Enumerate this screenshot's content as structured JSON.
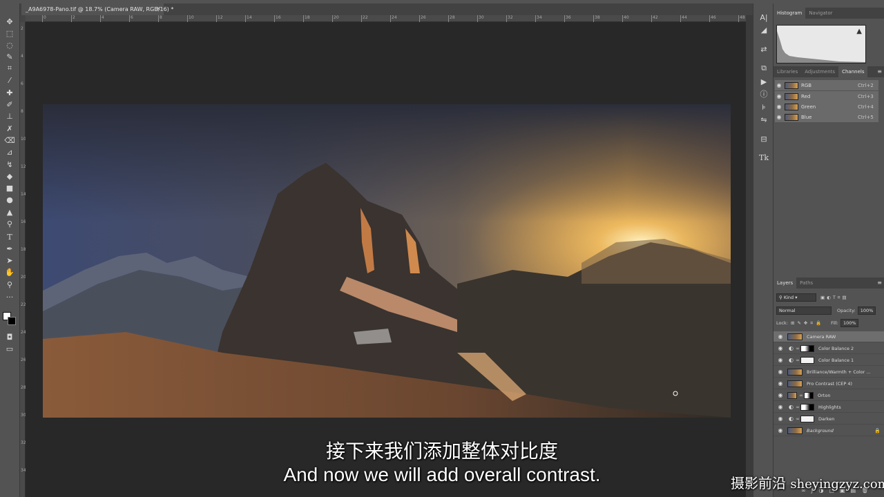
{
  "app": {
    "document_tab": "_A9A6978-Pano.tif @ 18.7% (Camera RAW, RGB/16) *",
    "tab_close": "×"
  },
  "ruler": {
    "h_ticks": [
      "0",
      "2",
      "4",
      "6",
      "8",
      "10",
      "12",
      "14",
      "16",
      "18",
      "20",
      "22",
      "24",
      "26",
      "28",
      "30",
      "32",
      "34",
      "36",
      "38",
      "40",
      "42",
      "44",
      "46",
      "48"
    ],
    "v_ticks": [
      "2",
      "4",
      "6",
      "8",
      "10",
      "12",
      "14",
      "16",
      "18",
      "20",
      "22",
      "24",
      "26",
      "28",
      "30",
      "32",
      "34"
    ]
  },
  "tools": [
    "move-icon",
    "marquee-icon",
    "lasso-icon",
    "quick-select-icon",
    "crop-icon",
    "eyedropper-icon",
    "healing-icon",
    "brush-icon",
    "stamp-icon",
    "history-brush-icon",
    "eraser-icon",
    "gradient-icon",
    "blur-icon",
    "dodge-icon",
    "pen-icon",
    "type-icon",
    "path-select-icon",
    "shape-icon",
    "hand-icon",
    "zoom-icon",
    "more-icon"
  ],
  "histogram_panel": {
    "tabs": [
      "Histogram",
      "Navigator"
    ],
    "warning": "▲"
  },
  "channels_panel": {
    "tabs": [
      "Libraries",
      "Adjustments",
      "Channels"
    ],
    "rows": [
      {
        "name": "RGB",
        "shortcut": "Ctrl+2"
      },
      {
        "name": "Red",
        "shortcut": "Ctrl+3"
      },
      {
        "name": "Green",
        "shortcut": "Ctrl+4"
      },
      {
        "name": "Blue",
        "shortcut": "Ctrl+5"
      }
    ]
  },
  "layers_panel": {
    "tabs": [
      "Layers",
      "Paths"
    ],
    "filter_kind": "Kind",
    "blend_mode": "Normal",
    "opacity_label": "Opacity:",
    "opacity_value": "100%",
    "lock_label": "Lock:",
    "fill_label": "Fill:",
    "fill_value": "100%",
    "layers": [
      {
        "name": "Camera RAW",
        "type": "pixel"
      },
      {
        "name": "Color Balance 2",
        "type": "adjustment",
        "mask": "dark"
      },
      {
        "name": "Color Balance 1",
        "type": "adjustment",
        "mask": "white"
      },
      {
        "name": "Brilliance/Warmth + Color ...",
        "type": "pixel"
      },
      {
        "name": "Pro Contrast (CEP 4)",
        "type": "pixel"
      },
      {
        "name": "Orton",
        "type": "pixel"
      },
      {
        "name": "Highlights",
        "type": "adjustment",
        "mask": "dark"
      },
      {
        "name": "Darken",
        "type": "adjustment",
        "mask": "white"
      },
      {
        "name": "Background",
        "type": "background"
      }
    ]
  },
  "subtitles": {
    "zh": "接下来我们添加整体对比度",
    "en": "And now we will add overall contrast."
  },
  "watermark": {
    "zh": "摄影前沿",
    "en": "sheyingzyz.com"
  },
  "colors": {
    "panel_bg": "#535353",
    "canvas_bg": "#282828",
    "selected_row": "#6e6e6e"
  }
}
